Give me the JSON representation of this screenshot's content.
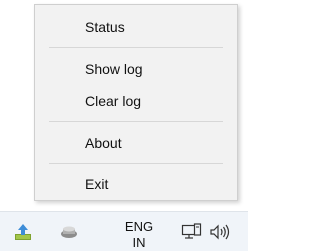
{
  "context_menu": {
    "items": [
      {
        "label": "Status"
      },
      {
        "label": "Show log"
      },
      {
        "label": "Clear log"
      },
      {
        "label": "About"
      },
      {
        "label": "Exit"
      }
    ]
  },
  "taskbar": {
    "language_line1": "ENG",
    "language_line2": "IN",
    "icons": [
      "upload-tray-icon",
      "app-tray-icon",
      "network-icon",
      "volume-icon"
    ]
  }
}
